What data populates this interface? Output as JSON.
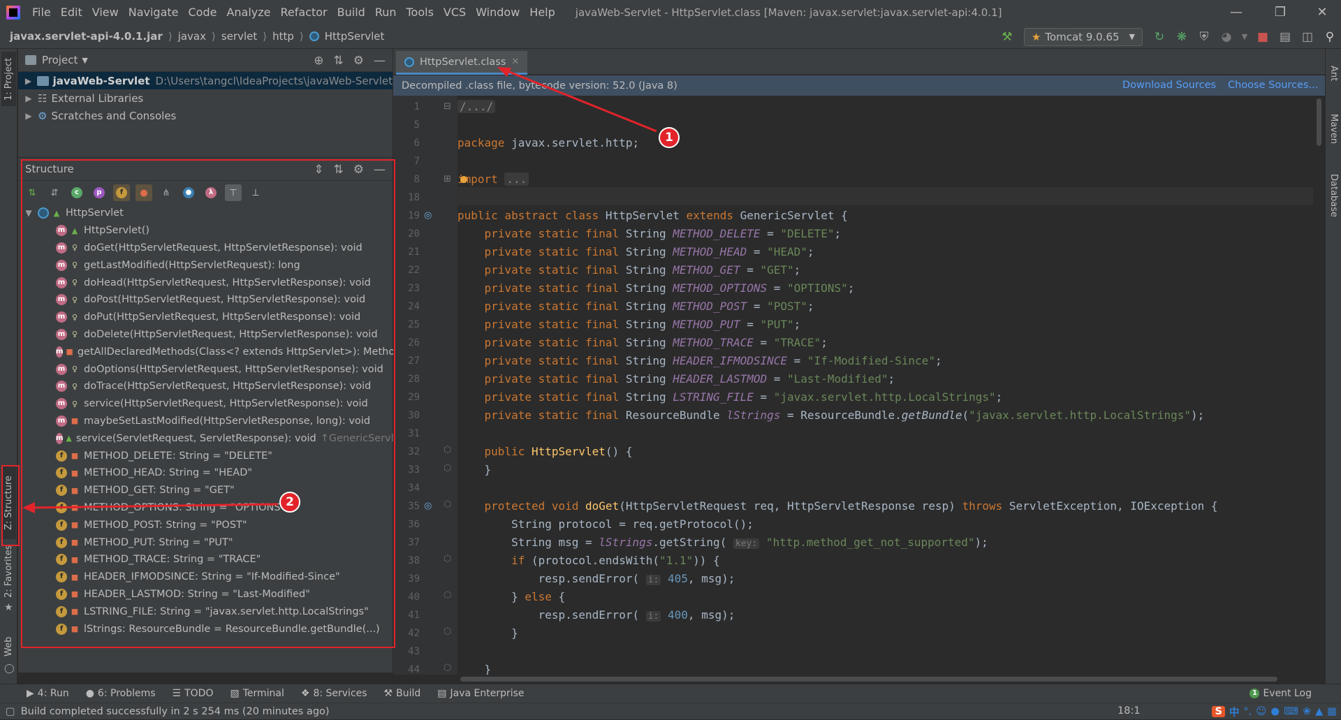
{
  "menubar": {
    "items": [
      "File",
      "Edit",
      "View",
      "Navigate",
      "Code",
      "Analyze",
      "Refactor",
      "Build",
      "Run",
      "Tools",
      "VCS",
      "Window",
      "Help"
    ],
    "title": "javaWeb-Servlet - HttpServlet.class [Maven: javax.servlet:javax.servlet-api:4.0.1]"
  },
  "navbar": {
    "crumbs": [
      "javax.servlet-api-4.0.1.jar",
      "javax",
      "servlet",
      "http",
      "HttpServlet"
    ],
    "run_config": "Tomcat 9.0.65"
  },
  "left_strip": {
    "project": "1: Project",
    "structure": "Z: Structure",
    "favorites": "2: Favorites",
    "web": "Web"
  },
  "right_strip": {
    "ant": "Ant",
    "maven": "Maven",
    "database": "Database"
  },
  "project_panel": {
    "title": "Project",
    "items": [
      {
        "name": "javaWeb-Servlet",
        "path": "D:\\Users\\tangcl\\IdeaProjects\\javaWeb-Servlet"
      },
      {
        "name": "External Libraries"
      },
      {
        "name": "Scratches and Consoles"
      }
    ]
  },
  "structure_panel": {
    "title": "Structure",
    "root": "HttpServlet",
    "members": [
      {
        "kind": "m",
        "vis": "pub",
        "text": "HttpServlet()"
      },
      {
        "kind": "m",
        "vis": "prot",
        "text": "doGet(HttpServletRequest, HttpServletResponse): void"
      },
      {
        "kind": "m",
        "vis": "prot",
        "text": "getLastModified(HttpServletRequest): long"
      },
      {
        "kind": "m",
        "vis": "prot",
        "text": "doHead(HttpServletRequest, HttpServletResponse): void"
      },
      {
        "kind": "m",
        "vis": "prot",
        "text": "doPost(HttpServletRequest, HttpServletResponse): void"
      },
      {
        "kind": "m",
        "vis": "prot",
        "text": "doPut(HttpServletRequest, HttpServletResponse): void"
      },
      {
        "kind": "m",
        "vis": "prot",
        "text": "doDelete(HttpServletRequest, HttpServletResponse): void"
      },
      {
        "kind": "m",
        "vis": "priv",
        "text": "getAllDeclaredMethods(Class<? extends HttpServlet>): Method[]"
      },
      {
        "kind": "m",
        "vis": "prot",
        "text": "doOptions(HttpServletRequest, HttpServletResponse): void"
      },
      {
        "kind": "m",
        "vis": "prot",
        "text": "doTrace(HttpServletRequest, HttpServletResponse): void"
      },
      {
        "kind": "m",
        "vis": "prot",
        "text": "service(HttpServletRequest, HttpServletResponse): void"
      },
      {
        "kind": "m",
        "vis": "priv",
        "text": "maybeSetLastModified(HttpServletResponse, long): void"
      },
      {
        "kind": "m",
        "vis": "pub",
        "text": "service(ServletRequest, ServletResponse): void",
        "inherited": "↑GenericServlet"
      },
      {
        "kind": "f",
        "vis": "priv",
        "text": "METHOD_DELETE: String = \"DELETE\""
      },
      {
        "kind": "f",
        "vis": "priv",
        "text": "METHOD_HEAD: String = \"HEAD\""
      },
      {
        "kind": "f",
        "vis": "priv",
        "text": "METHOD_GET: String = \"GET\""
      },
      {
        "kind": "f",
        "vis": "priv",
        "text": "METHOD_OPTIONS: String = \"OPTIONS\""
      },
      {
        "kind": "f",
        "vis": "priv",
        "text": "METHOD_POST: String = \"POST\""
      },
      {
        "kind": "f",
        "vis": "priv",
        "text": "METHOD_PUT: String = \"PUT\""
      },
      {
        "kind": "f",
        "vis": "priv",
        "text": "METHOD_TRACE: String = \"TRACE\""
      },
      {
        "kind": "f",
        "vis": "priv",
        "text": "HEADER_IFMODSINCE: String = \"If-Modified-Since\""
      },
      {
        "kind": "f",
        "vis": "priv",
        "text": "HEADER_LASTMOD: String = \"Last-Modified\""
      },
      {
        "kind": "f",
        "vis": "priv",
        "text": "LSTRING_FILE: String = \"javax.servlet.http.LocalStrings\""
      },
      {
        "kind": "f",
        "vis": "priv",
        "text": "lStrings: ResourceBundle = ResourceBundle.getBundle(...)"
      }
    ]
  },
  "editor": {
    "tab": "HttpServlet.class",
    "banner": "Decompiled .class file, bytecode version: 52.0 (Java 8)",
    "download_sources": "Download Sources",
    "choose_sources": "Choose Sources...",
    "line_numbers": [
      "1",
      "5",
      "6",
      "7",
      "8",
      "18",
      "19",
      "20",
      "21",
      "22",
      "23",
      "24",
      "25",
      "26",
      "27",
      "28",
      "29",
      "30",
      "31",
      "32",
      "33",
      "34",
      "35",
      "36",
      "37",
      "38",
      "39",
      "40",
      "41",
      "42",
      "43",
      "44"
    ]
  },
  "bottom_tools": [
    "4: Run",
    "6: Problems",
    "TODO",
    "Terminal",
    "8: Services",
    "Build",
    "Java Enterprise",
    "Event Log"
  ],
  "status": {
    "message": "Build completed successfully in 2 s 254 ms (20 minutes ago)",
    "position": "18:1"
  },
  "annotations": {
    "one": "1",
    "two": "2"
  },
  "colors": {
    "annotation_red": "#e2242a",
    "keyword": "#cc7832",
    "string": "#6a8759",
    "field": "#9876aa",
    "link": "#589df6"
  }
}
